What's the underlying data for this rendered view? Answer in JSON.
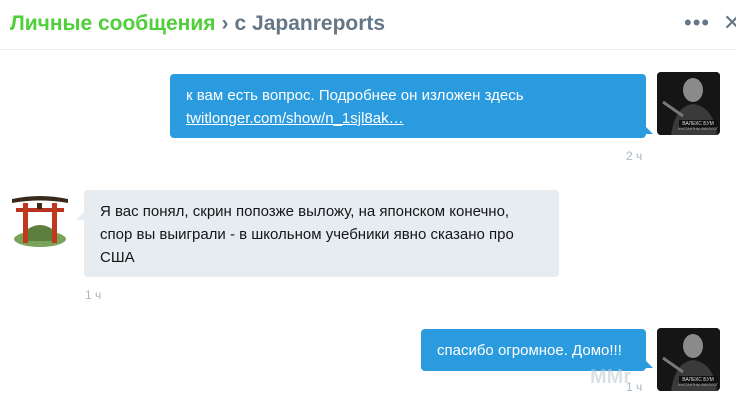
{
  "header": {
    "section": "Личные сообщения",
    "separator": "›",
    "conversation": "с Japanreports",
    "more_icon": "more-dots-icon",
    "close_icon": "close-icon"
  },
  "messages": [
    {
      "direction": "outgoing",
      "text_line1": "к вам есть вопрос. Подробнее он изложен здесь",
      "link": "twitlonger.com/show/n_1sjl8ak…",
      "time": "2 ч"
    },
    {
      "direction": "incoming",
      "text_line1": "Я вас понял, скрин попозже выложу, на японском конечно,",
      "text_line2": "спор вы выиграли - в школьном учебники явно сказано про",
      "text_line3": "США",
      "time": "1 ч"
    },
    {
      "direction": "outgoing",
      "text_line1": "спасибо огромное. Домо!!!",
      "time": "1 ч"
    }
  ],
  "avatars": {
    "me_caption": "ВАЛЕКС БУМ",
    "me_subcaption": "ИНСТАНТНЫ ФИЛОЛОГ"
  },
  "watermark": "MMr",
  "colors": {
    "accent_green": "#4fcf3a",
    "bubble_blue": "#2b9bdf",
    "bubble_gray": "#e6ecf0",
    "muted": "#657786"
  }
}
